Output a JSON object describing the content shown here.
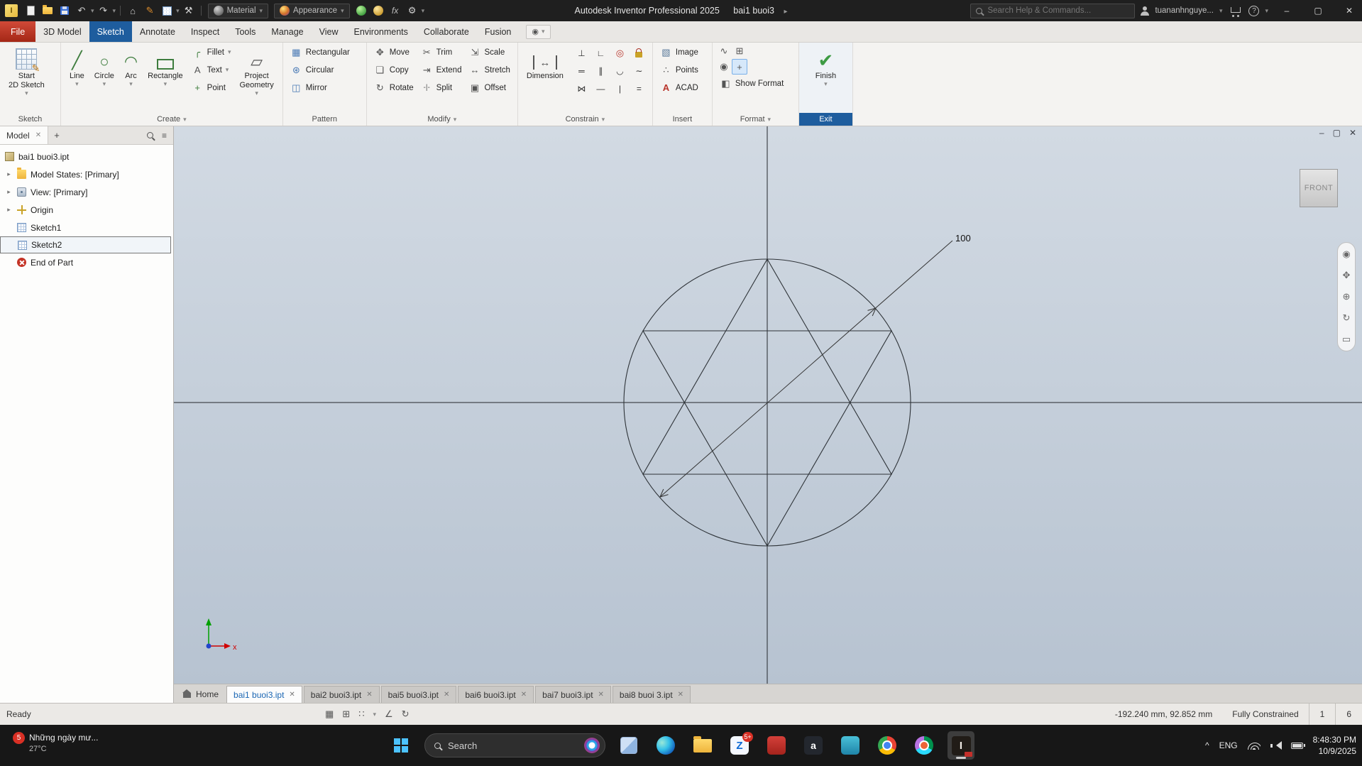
{
  "titlebar": {
    "app_title": "Autodesk Inventor Professional 2025",
    "doc_title": "bai1 buoi3",
    "search_placeholder": "Search Help & Commands...",
    "user_name": "tuananhnguye...",
    "material_label": "Material",
    "appearance_label": "Appearance",
    "fx_label": "fx"
  },
  "tabs": {
    "file": "File",
    "model3d": "3D Model",
    "sketch": "Sketch",
    "annotate": "Annotate",
    "inspect": "Inspect",
    "tools": "Tools",
    "manage": "Manage",
    "view": "View",
    "environments": "Environments",
    "collaborate": "Collaborate",
    "fusion": "Fusion"
  },
  "ribbon": {
    "sketch": {
      "label": "Sketch",
      "start_line1": "Start",
      "start_line2": "2D Sketch"
    },
    "create": {
      "label": "Create",
      "line": "Line",
      "circle": "Circle",
      "arc": "Arc",
      "rectangle": "Rectangle",
      "fillet": "Fillet",
      "text": "Text",
      "point": "Point",
      "project_line1": "Project",
      "project_line2": "Geometry"
    },
    "pattern": {
      "label": "Pattern",
      "rectangular": "Rectangular",
      "circular": "Circular",
      "mirror": "Mirror"
    },
    "modify": {
      "label": "Modify",
      "move": "Move",
      "copy": "Copy",
      "rotate": "Rotate",
      "trim": "Trim",
      "extend": "Extend",
      "split": "Split",
      "scale": "Scale",
      "stretch": "Stretch",
      "offset": "Offset"
    },
    "constrain": {
      "label": "Constrain",
      "dimension": "Dimension"
    },
    "insert": {
      "label": "Insert",
      "image": "Image",
      "points": "Points",
      "acad": "ACAD"
    },
    "format": {
      "label": "Format",
      "show_format": "Show Format"
    },
    "exit": {
      "label": "Exit",
      "finish": "Finish"
    }
  },
  "browser": {
    "panel_tab": "Model",
    "items": [
      {
        "label": "bai1 buoi3.ipt"
      },
      {
        "label": "Model States: [Primary]"
      },
      {
        "label": "View: [Primary]"
      },
      {
        "label": "Origin"
      },
      {
        "label": "Sketch1"
      },
      {
        "label": "Sketch2"
      },
      {
        "label": "End of Part"
      }
    ]
  },
  "canvas": {
    "dimension_value": "100",
    "viewcube_face": "FRONT"
  },
  "doc_tabs": {
    "home": "Home",
    "files": [
      "bai1 buoi3.ipt",
      "bai2 buoi3.ipt",
      "bai5 buoi3.ipt",
      "bai6 buoi3.ipt",
      "bai7 buoi3.ipt",
      "bai8 buoi 3.ipt"
    ]
  },
  "statusbar": {
    "ready": "Ready",
    "coords": "-192.240 mm, 92.852 mm",
    "constraint_status": "Fully Constrained",
    "sketch_number": "1",
    "dimension_count": "6"
  },
  "taskbar": {
    "widget_badge": "5",
    "widget_title": "Những ngày mư...",
    "widget_temp": "27°C",
    "search_label": "Search",
    "zalo_badge": "5+",
    "language": "ENG",
    "time": "8:48:30 PM",
    "date": "10/9/2025"
  },
  "colors": {
    "accent_blue": "#1e5d9e",
    "file_tab_red": "#bb2f21",
    "finish_green": "#3d9b43"
  },
  "icons": {
    "inventor_letter": "I",
    "undo": "↶",
    "redo": "↷",
    "home": "⌂",
    "pencil": "✎",
    "tools": "⚒",
    "gear": "⚙",
    "dropdown": "▾",
    "caret_right": "▸",
    "close": "✕",
    "minimize": "–",
    "restore": "▢",
    "hamburger": "≡",
    "plus": "+",
    "help": "?",
    "ribbon_eye": "◉",
    "chevron_up": "^",
    "line": "╱",
    "circle": "○",
    "arc": "◠",
    "fillet": "╭",
    "text_tool": "A",
    "point": "+",
    "project": "▱",
    "rectangular": "▦",
    "circular": "⊛",
    "mirror": "◫",
    "move": "✥",
    "copy": "❏",
    "rotate": "↻",
    "trim": "✂",
    "extend": "⇥",
    "split": "-|-",
    "scale": "⇲",
    "stretch": "↔",
    "offset": "▣",
    "dim_arrow": "↔",
    "image": "▧",
    "points": "∴",
    "acad_a": "A",
    "finish_check": "✔",
    "c_perpendicular": "⊥",
    "c_coincident": "∟",
    "c_concentric": "◎",
    "c_collinear": "═",
    "c_parallel": "∥",
    "c_tangent": "◡",
    "c_smooth": "∼",
    "c_symmetric": "⋈",
    "c_horizontal": "―",
    "c_vertical": "|",
    "c_equal": "=",
    "fmt_wave": "∿",
    "fmt_grid": "⊞",
    "fmt_target": "+",
    "fmt_show": "◧",
    "nav_wheel": "◉",
    "nav_pan": "✥",
    "nav_zoom": "⊕",
    "nav_orbit": "↻",
    "nav_look": "▭",
    "sb_grid": "▦",
    "sb_snap": "⊞",
    "sb_precise": "∷",
    "sb_measure": "∠",
    "sb_update": "↻",
    "zalo_letter": "Z",
    "a_letter": "a"
  }
}
